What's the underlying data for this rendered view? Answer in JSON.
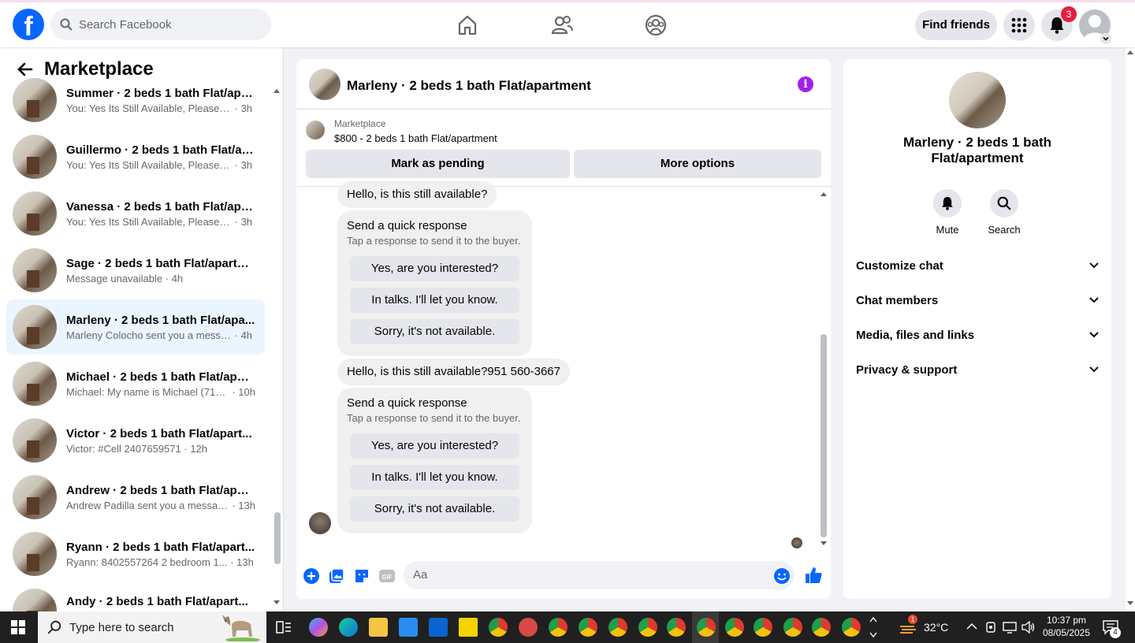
{
  "topbar": {
    "logo_letter": "f",
    "search_placeholder": "Search Facebook",
    "find_friends_label": "Find friends",
    "notification_count": "3"
  },
  "sidebar": {
    "title": "Marketplace",
    "conversations": [
      {
        "name": "Summer · 2 beds 1 bath Flat/apa...",
        "preview": "You: Yes Its Still Available, Please Se...",
        "time": "3h"
      },
      {
        "name": "Guillermo · 2 beds 1 bath Flat/ap...",
        "preview": "You: Yes Its Still Available, Please Se...",
        "time": "3h"
      },
      {
        "name": "Vanessa · 2 beds 1 bath Flat/apa...",
        "preview": "You: Yes Its Still Available, Please Se...",
        "time": "3h"
      },
      {
        "name": "Sage · 2 beds 1 bath Flat/apartm...",
        "preview": "Message unavailable",
        "time": "4h"
      },
      {
        "name": "Marleny · 2 beds 1 bath Flat/apa...",
        "preview": "Marleny Colocho sent you a messa...",
        "time": "4h"
      },
      {
        "name": "Michael · 2 beds 1 bath Flat/apar...",
        "preview": "Michael: My name is Michael (714...",
        "time": "10h"
      },
      {
        "name": "Victor · 2 beds 1 bath Flat/apart...",
        "preview": "Victor: #Cell 2407659571",
        "time": "12h"
      },
      {
        "name": "Andrew · 2 beds 1 bath Flat/apar...",
        "preview": "Andrew Padilla sent you a messag...",
        "time": "13h"
      },
      {
        "name": "Ryann · 2 beds 1 bath Flat/apart...",
        "preview": "Ryann: 8402557264 2 bedroom 1...",
        "time": "13h"
      },
      {
        "name": "Andy · 2 beds 1 bath Flat/apart...",
        "preview": "",
        "time": ""
      }
    ]
  },
  "chat": {
    "title": "Marleny · 2 beds 1 bath Flat/apartment",
    "marketplace_label": "Marketplace",
    "listing": "$800 - 2 beds 1 bath Flat/apartment",
    "mark_pending_label": "Mark as pending",
    "more_options_label": "More options",
    "messages": [
      {
        "text": "Hello, is this still available?"
      },
      {
        "text": "Hello, is this still available?951 560-3667"
      }
    ],
    "quick_response": {
      "heading": "Send a quick response",
      "subtext": "Tap a response to send it to the buyer.",
      "options": [
        "Yes, are you interested?",
        "In talks. I'll let you know.",
        "Sorry, it's not available."
      ]
    },
    "composer_placeholder": "Aa",
    "gif_label": "GIF"
  },
  "info_panel": {
    "name": "Marleny · 2 beds 1 bath Flat/apartment",
    "mute_label": "Mute",
    "search_label": "Search",
    "sections": [
      "Customize chat",
      "Chat members",
      "Media, files and links",
      "Privacy & support"
    ]
  },
  "taskbar": {
    "search_placeholder": "Type here to search",
    "temperature": "32°C",
    "time": "10:37 pm",
    "date": "08/05/2025",
    "notification_count": "4",
    "weather_alert": "1"
  },
  "colors": {
    "brand": "#0866ff",
    "active_conv": "#ebf5ff",
    "info_icon": "#a020f0",
    "badge": "#e41e3f"
  }
}
